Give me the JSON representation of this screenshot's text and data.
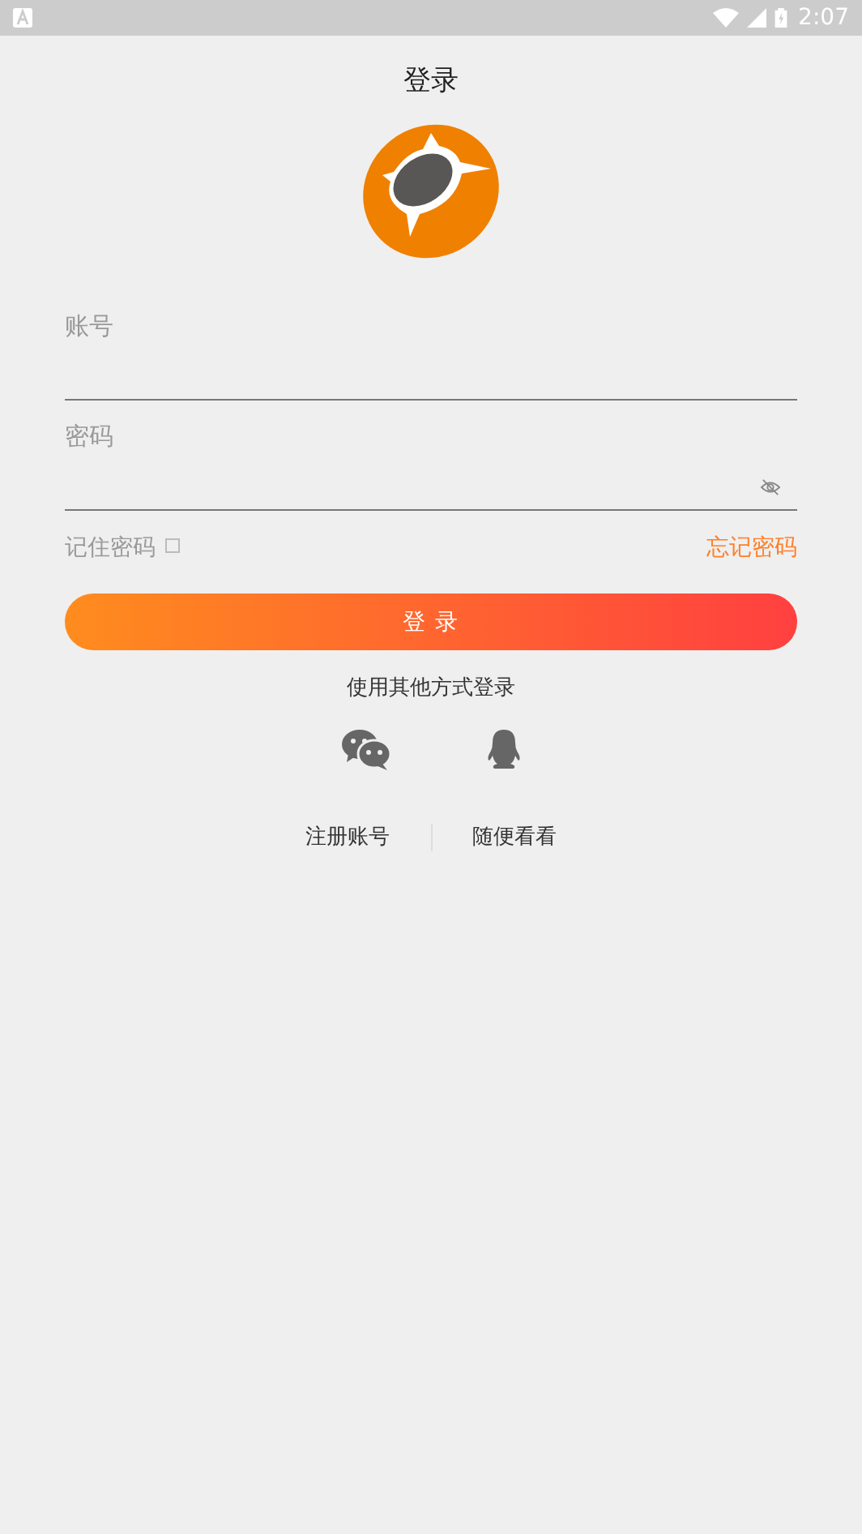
{
  "status_bar": {
    "time": "2:07"
  },
  "title": "登录",
  "fields": [
    {
      "label": "账号",
      "kind": "text"
    },
    {
      "label": "密码",
      "kind": "password"
    }
  ],
  "remember": {
    "label": "记住密码",
    "checked": false
  },
  "forgot": "忘记密码",
  "login_button": "登 录",
  "other_login": "使用其他方式登录",
  "social": [
    {
      "kind": "wechat"
    },
    {
      "kind": "qq"
    }
  ],
  "links": [
    "注册账号",
    "随便看看"
  ]
}
